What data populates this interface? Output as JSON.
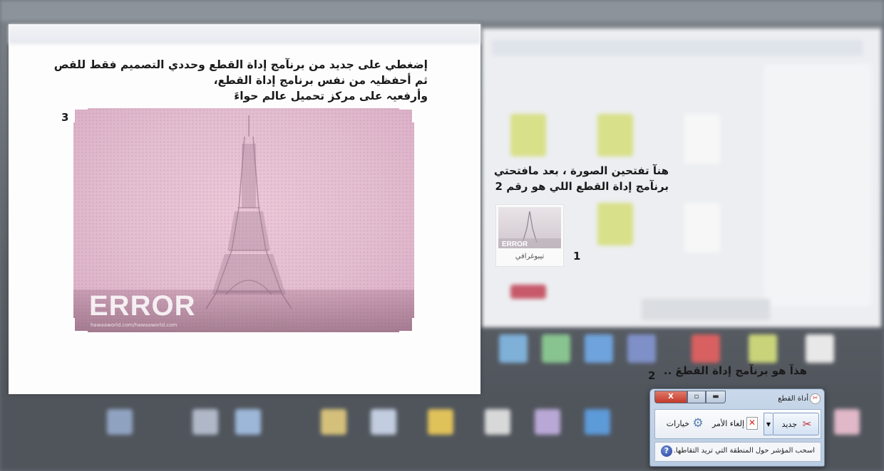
{
  "instructions": {
    "line1": "إضغطي على جديد من برنآمج إداة القطع وحددي التصميم فقط للقص",
    "line2": "ثم أحفظيہ من نفس برنامج إداة القطع،",
    "line3": "وأرفعيہ على مركز تحميل عالم حواءَ"
  },
  "step_numbers": {
    "one": "1",
    "two": "2",
    "three": "3"
  },
  "capture_image": {
    "brand_text": "ERROR",
    "watermark_text": "hawaaworld.com/hawaaworld.com"
  },
  "caption": {
    "line1": "هنآ تفتحين الصورة ، بعد مافتحتي",
    "line2": "برنآمج إداة القطع اللي هو رقم 2"
  },
  "thumbnail": {
    "label": "تيبوغرافي",
    "image_text": "ERROR"
  },
  "tool_caption": "هذآ هو برنآمج إداة القطعَ ..",
  "snipping_tool": {
    "title": "أداة القطع",
    "new_label": "جديد",
    "cancel_label": "إلغاء الأمر",
    "options_label": "خيارات",
    "status_text": "اسحب المؤشر حول المنطقة التي تريد التقاطها.",
    "help_glyph": "?",
    "close_glyph": "X"
  },
  "colors": {
    "capture_pink": "#e3bdd0",
    "snip_close_red": "#c3392a",
    "snip_frame_blue": "#b8cbe2"
  },
  "icons": [
    "scissors-icon",
    "cancel-x-icon",
    "gear-icon",
    "help-icon",
    "close-icon",
    "maximize-icon",
    "minimize-icon",
    "dropdown-arrow-icon"
  ]
}
